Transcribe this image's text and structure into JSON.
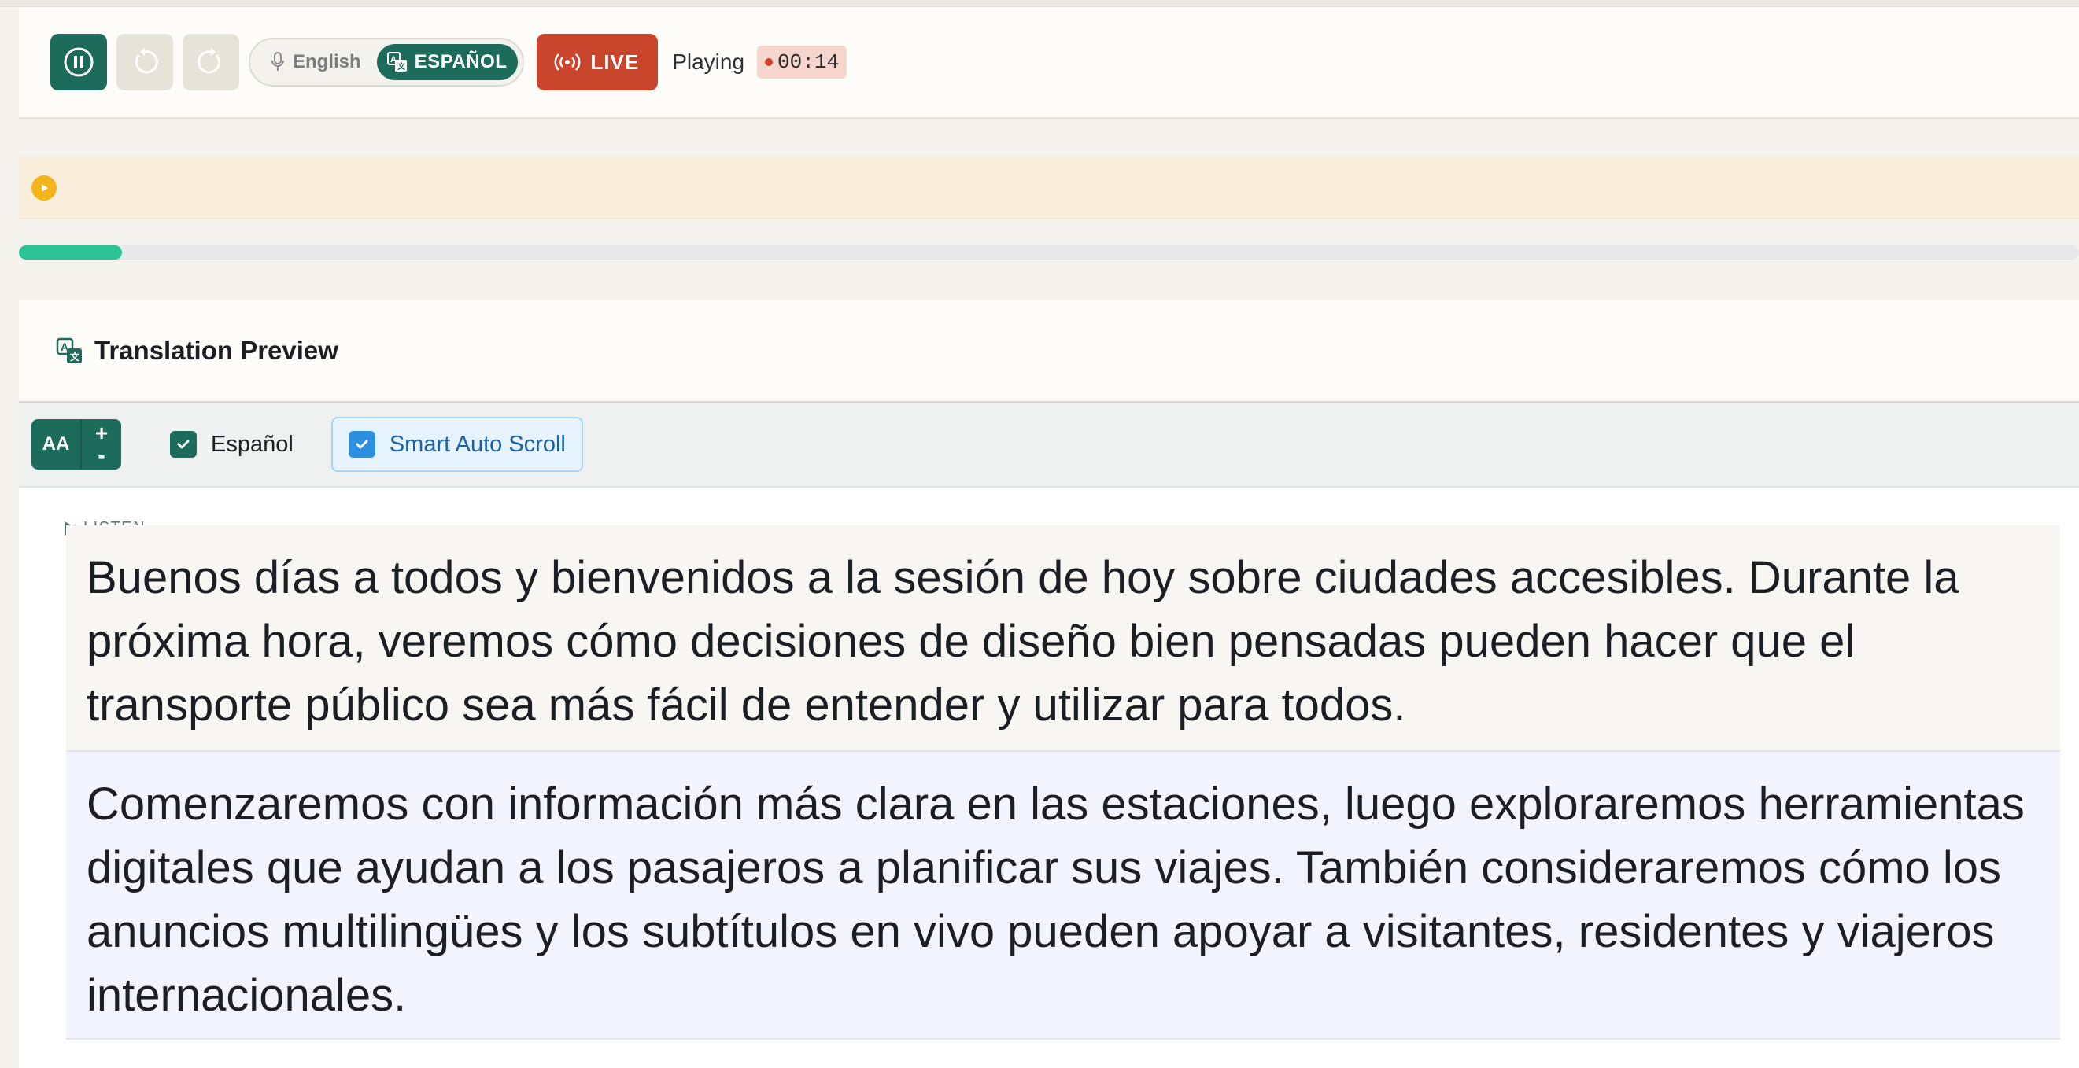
{
  "toolbar": {
    "language_source": "English",
    "language_target": "ESPAÑOL",
    "live_label": "LIVE",
    "status": "Playing",
    "timer": "00:14"
  },
  "audio": {
    "progress_fraction": 0.05
  },
  "preview": {
    "title": "Translation Preview",
    "font_size_label": "AA",
    "font_increase": "+",
    "font_decrease": "-",
    "language_option": "Español",
    "smart_scroll_label": "Smart Auto Scroll",
    "listen_label": "LISTEN",
    "paragraphs": [
      "Buenos días a todos y bienvenidos a la sesión de hoy sobre ciudades accesibles. Durante la próxima hora, veremos cómo decisiones de diseño bien pensadas pueden hacer que el transporte público sea más fácil de entender y utilizar para todos.",
      "Comenzaremos con información más clara en las estaciones, luego exploraremos herramientas digitales que ayudan a los pasajeros a planificar sus viajes. También consideraremos cómo los anuncios multilingües y los subtítulos en vivo pueden apoyar a visitantes, residentes y viajeros internacionales."
    ]
  },
  "colors": {
    "primary": "#1d6b5a",
    "live": "#c9452c",
    "progress": "#29c396",
    "banner": "#f8eedb",
    "accent_blue": "#2c8fe0"
  },
  "icons": [
    "pause-icon",
    "rewind-icon",
    "forward-icon",
    "microphone-icon",
    "translate-icon",
    "broadcast-icon",
    "play-icon",
    "check-icon"
  ]
}
